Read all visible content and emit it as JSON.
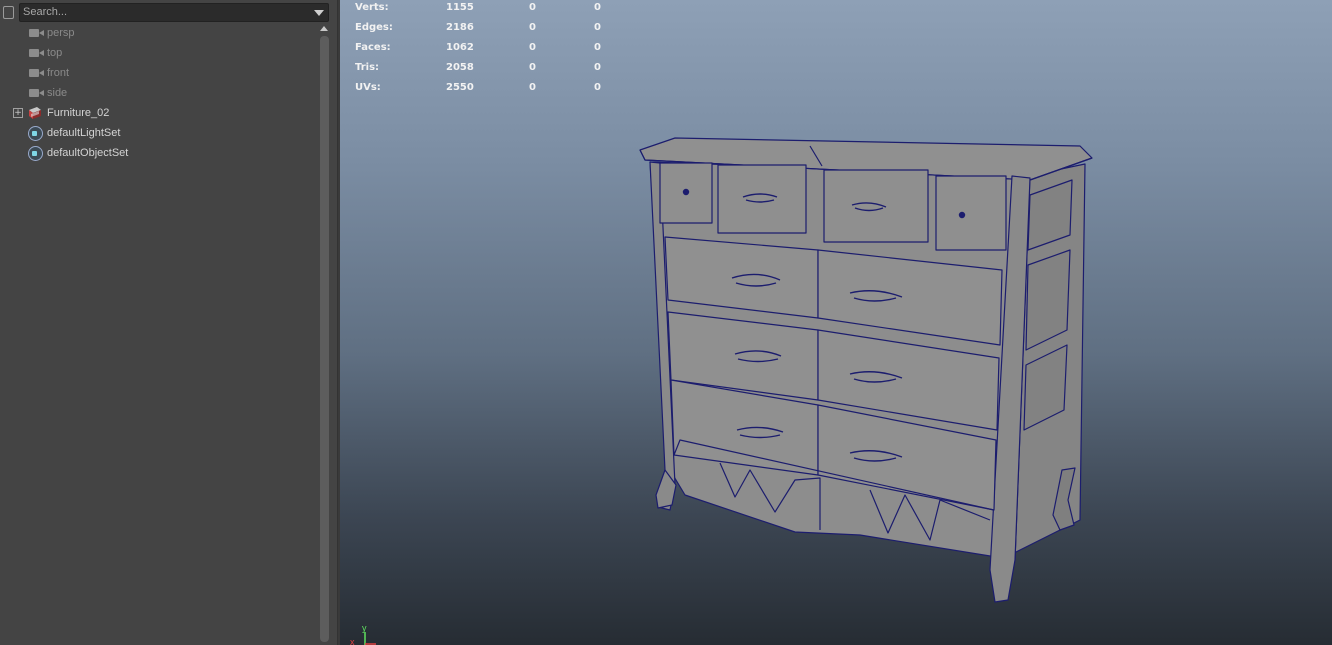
{
  "outliner": {
    "search": {
      "placeholder": "Search..."
    },
    "items": [
      {
        "label": "persp",
        "icon": "camera-icon",
        "dim": true
      },
      {
        "label": "top",
        "icon": "camera-icon",
        "dim": true
      },
      {
        "label": "front",
        "icon": "camera-icon",
        "dim": true
      },
      {
        "label": "side",
        "icon": "camera-icon",
        "dim": true
      },
      {
        "label": "Furniture_02",
        "icon": "group-icon",
        "expandable": true
      },
      {
        "label": "defaultLightSet",
        "icon": "set-icon"
      },
      {
        "label": "defaultObjectSet",
        "icon": "set-icon"
      }
    ]
  },
  "hud": {
    "rows": [
      {
        "label": "Verts:",
        "v1": "1155",
        "v2": "0",
        "v3": "0"
      },
      {
        "label": "Edges:",
        "v1": "2186",
        "v2": "0",
        "v3": "0"
      },
      {
        "label": "Faces:",
        "v1": "1062",
        "v2": "0",
        "v3": "0"
      },
      {
        "label": "Tris:",
        "v1": "2058",
        "v2": "0",
        "v3": "0"
      },
      {
        "label": "UVs:",
        "v1": "2550",
        "v2": "0",
        "v3": "0"
      }
    ]
  },
  "axis": {
    "x_label": "x",
    "y_label": "y",
    "x_color": "#e04040",
    "y_color": "#5fe05f"
  },
  "colors": {
    "wire": "#1c1d6e",
    "mesh_face": "#8c8c8c",
    "viewport_top": "#8ea0b6",
    "viewport_bottom": "#262c33"
  }
}
